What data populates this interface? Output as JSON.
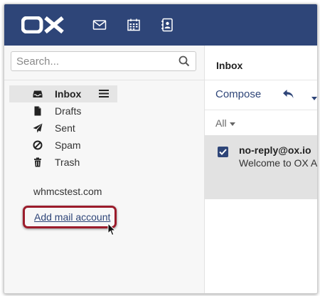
{
  "header": {
    "logo_text": "OX",
    "icons": [
      "mail-icon",
      "calendar-icon",
      "address-book-icon"
    ]
  },
  "sidebar": {
    "search": {
      "placeholder": "Search...",
      "value": ""
    },
    "folders": [
      {
        "label": "Inbox",
        "icon": "inbox-icon",
        "selected": true
      },
      {
        "label": "Drafts",
        "icon": "document-icon",
        "selected": false
      },
      {
        "label": "Sent",
        "icon": "paper-plane-icon",
        "selected": false
      },
      {
        "label": "Spam",
        "icon": "ban-icon",
        "selected": false
      },
      {
        "label": "Trash",
        "icon": "trash-icon",
        "selected": false
      }
    ],
    "account_name": "whmcstest.com",
    "add_account_label": "Add mail account"
  },
  "main": {
    "folder_title": "Inbox",
    "toolbar": {
      "compose_label": "Compose"
    },
    "filter_label": "All",
    "messages": [
      {
        "sender": "no-reply@ox.io",
        "subject": "Welcome to OX Ap",
        "checked": true
      }
    ]
  },
  "colors": {
    "header_bg": "#2e4578",
    "accent": "#2e4578",
    "highlight_border": "#9b1c2b",
    "sidebar_bg": "#f7f7f7",
    "selected_row_bg": "#e2e2e2"
  }
}
